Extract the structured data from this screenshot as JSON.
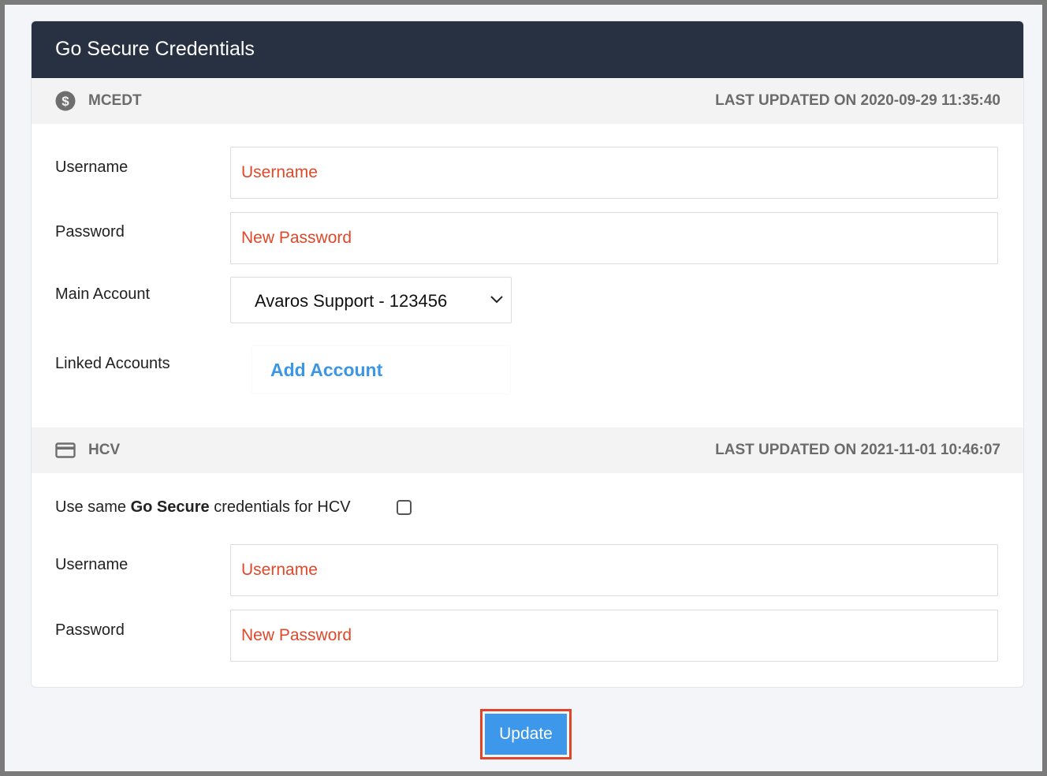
{
  "page": {
    "title": "Go Secure Credentials"
  },
  "mcedt": {
    "name": "MCEDT",
    "icon": "dollar-circle-icon",
    "last_updated": "LAST UPDATED ON 2020-09-29 11:35:40",
    "username_label": "Username",
    "username_placeholder": "Username",
    "password_label": "Password",
    "password_placeholder": "New Password",
    "main_account_label": "Main Account",
    "main_account_value": "Avaros Support - 123456",
    "linked_accounts_label": "Linked Accounts",
    "add_account_label": "Add Account"
  },
  "hcv": {
    "name": "HCV",
    "icon": "credit-card-icon",
    "last_updated": "LAST UPDATED ON 2021-11-01 10:46:07",
    "same_creds_prefix": "Use same ",
    "same_creds_bold": "Go Secure",
    "same_creds_suffix": " credentials for HCV",
    "same_creds_checked": false,
    "username_label": "Username",
    "username_placeholder": "Username",
    "password_label": "Password",
    "password_placeholder": "New Password"
  },
  "actions": {
    "update_label": "Update"
  },
  "colors": {
    "header_bg": "#273142",
    "accent_blue": "#3d97ea",
    "placeholder_red": "#e0482a",
    "highlight_red": "#e0442b"
  }
}
